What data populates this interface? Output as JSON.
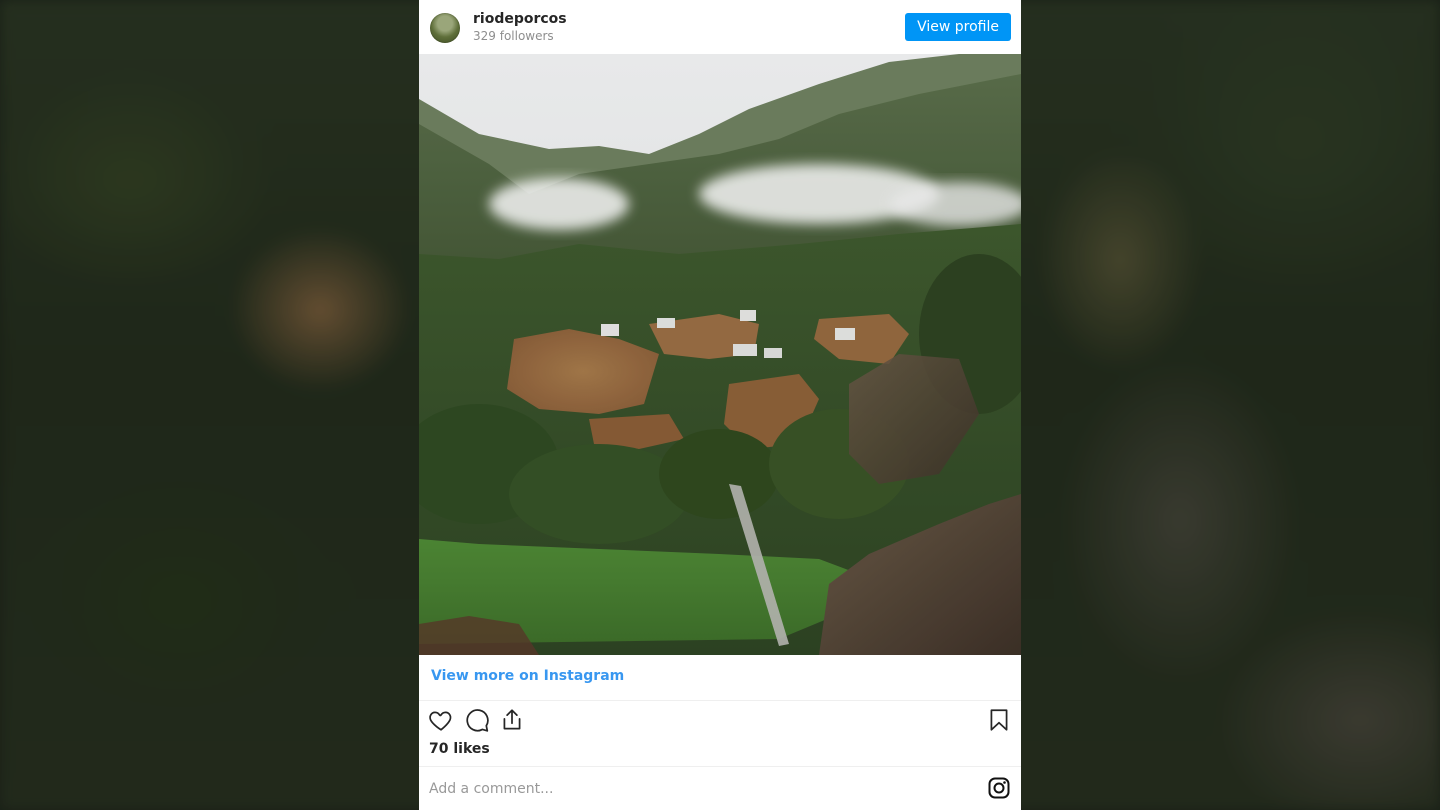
{
  "post": {
    "username": "riodeporcos",
    "followers": "329 followers",
    "view_profile_label": "View profile",
    "view_more_label": "View more on Instagram",
    "likes": "70 likes",
    "comment_placeholder": "Add a comment..."
  },
  "icons": {
    "like": "heart-icon",
    "comment": "comment-icon",
    "share": "share-icon",
    "save": "bookmark-icon",
    "brand": "instagram-icon"
  },
  "colors": {
    "accent": "#0095f6",
    "link": "#3897f0",
    "text": "#262626",
    "muted": "#8e8e8e"
  }
}
